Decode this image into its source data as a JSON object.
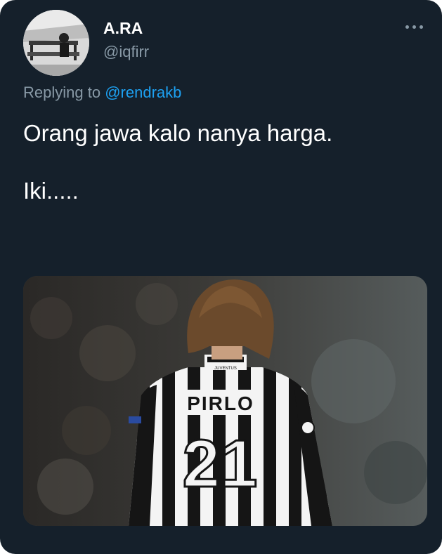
{
  "tweet": {
    "author": {
      "display_name": "A.RA",
      "handle": "@iqfirr"
    },
    "replying_to": {
      "prefix": "Replying to",
      "mention": "@rendrakb"
    },
    "text_lines": [
      "Orang jawa kalo nanya harga.",
      "Iki....."
    ],
    "media": {
      "kind": "photo",
      "jersey": {
        "club_text": "JUVENTUS",
        "name": "PIRLO",
        "number": "21"
      }
    }
  },
  "colors": {
    "background": "#15202b",
    "primary_text": "#ffffff",
    "secondary_text": "#8899a6",
    "link": "#1da1f2"
  },
  "icons": {
    "more": "more-horizontal-icon"
  }
}
